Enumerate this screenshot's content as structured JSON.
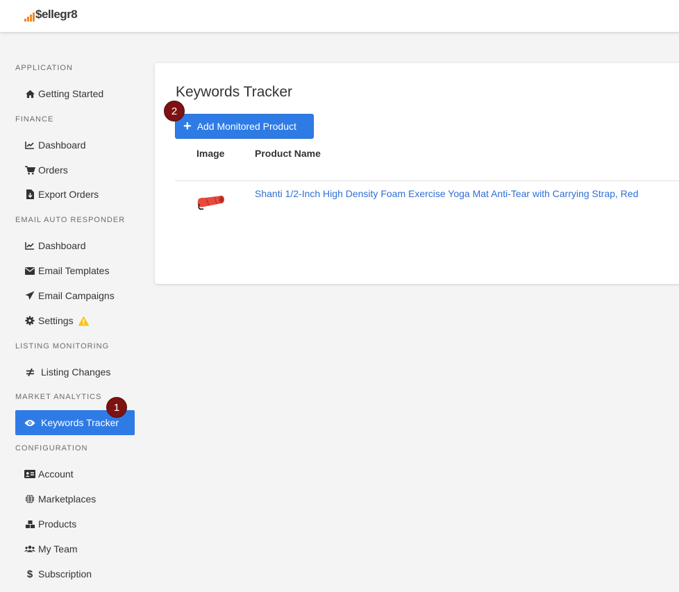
{
  "app": {
    "logo_text": "$ellegr8"
  },
  "sidebar": {
    "sections": {
      "application": "APPLICATION",
      "finance": "FINANCE",
      "email": "EMAIL AUTO RESPONDER",
      "listing": "LISTING MONITORING",
      "market": "MARKET ANALYTICS",
      "configuration": "CONFIGURATION"
    },
    "items": {
      "getting_started": "Getting Started",
      "finance_dashboard": "Dashboard",
      "orders": "Orders",
      "export_orders": "Export Orders",
      "email_dashboard": "Dashboard",
      "email_templates": "Email Templates",
      "email_campaigns": "Email Campaigns",
      "settings": "Settings",
      "listing_changes": "Listing Changes",
      "keywords_tracker": "Keywords Tracker",
      "account": "Account",
      "marketplaces": "Marketplaces",
      "products": "Products",
      "my_team": "My Team",
      "subscription": "Subscription"
    }
  },
  "badges": {
    "first": "1",
    "second": "2"
  },
  "main": {
    "title": "Keywords Tracker",
    "add_button": "Add Monitored Product",
    "columns": {
      "image": "Image",
      "product_name": "Product Name"
    },
    "rows": [
      {
        "product_name": "Shanti 1/2-Inch High Density Foam Exercise Yoga Mat Anti-Tear with Carrying Strap, Red"
      }
    ]
  },
  "colors": {
    "accent": "#2f7be6",
    "badge": "#7d1212",
    "link": "#2f6fd6",
    "warning": "#f5c518",
    "logo_bars": "#f08a24"
  }
}
